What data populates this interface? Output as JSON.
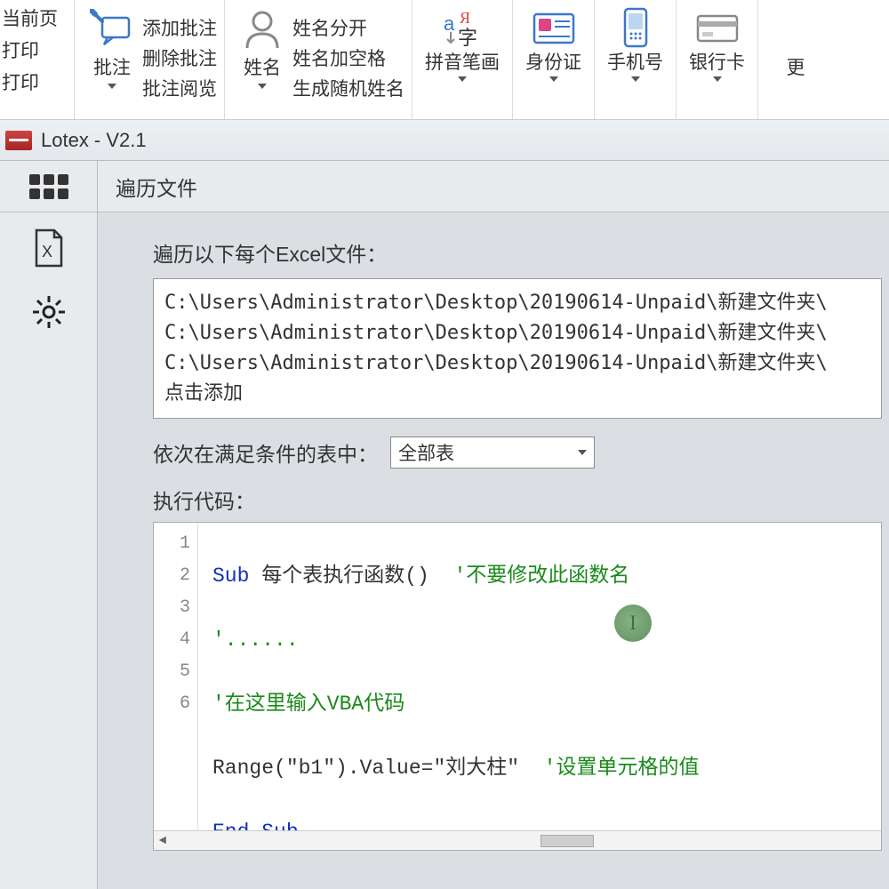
{
  "ribbon": {
    "left_items": [
      "当前页",
      "打印",
      "打印"
    ],
    "annotation": {
      "label": "批注",
      "items": [
        "添加批注",
        "删除批注",
        "批注阅览"
      ]
    },
    "name": {
      "label": "姓名",
      "items": [
        "姓名分开",
        "姓名加空格",
        "生成随机姓名"
      ]
    },
    "pinyin_label": "拼音笔画",
    "id_label": "身份证",
    "phone_label": "手机号",
    "bank_label": "银行卡",
    "more_label": "更"
  },
  "titlebar": {
    "text": "Lotex - V2.1"
  },
  "tab": {
    "title": "遍历文件"
  },
  "content": {
    "files_label": "遍历以下每个Excel文件：",
    "file_paths": [
      "C:\\Users\\Administrator\\Desktop\\20190614-Unpaid\\新建文件夹\\",
      "C:\\Users\\Administrator\\Desktop\\20190614-Unpaid\\新建文件夹\\",
      "C:\\Users\\Administrator\\Desktop\\20190614-Unpaid\\新建文件夹\\"
    ],
    "add_hint": "点击添加",
    "condition_label": "依次在满足条件的表中：",
    "select_value": "全部表",
    "code_label": "执行代码：",
    "code": {
      "l1_kw": "Sub ",
      "l1_fn": "每个表执行函数()  ",
      "l1_cm": "'不要修改此函数名",
      "l2": "'......",
      "l3": "'在这里输入VBA代码",
      "l4_a": "Range(\"b1\").Value=",
      "l4_b": "\"刘大柱\"  ",
      "l4_c": "'设置单元格的值",
      "l5": "End Sub"
    },
    "line_numbers": [
      "1",
      "2",
      "3",
      "4",
      "5",
      "6"
    ]
  }
}
